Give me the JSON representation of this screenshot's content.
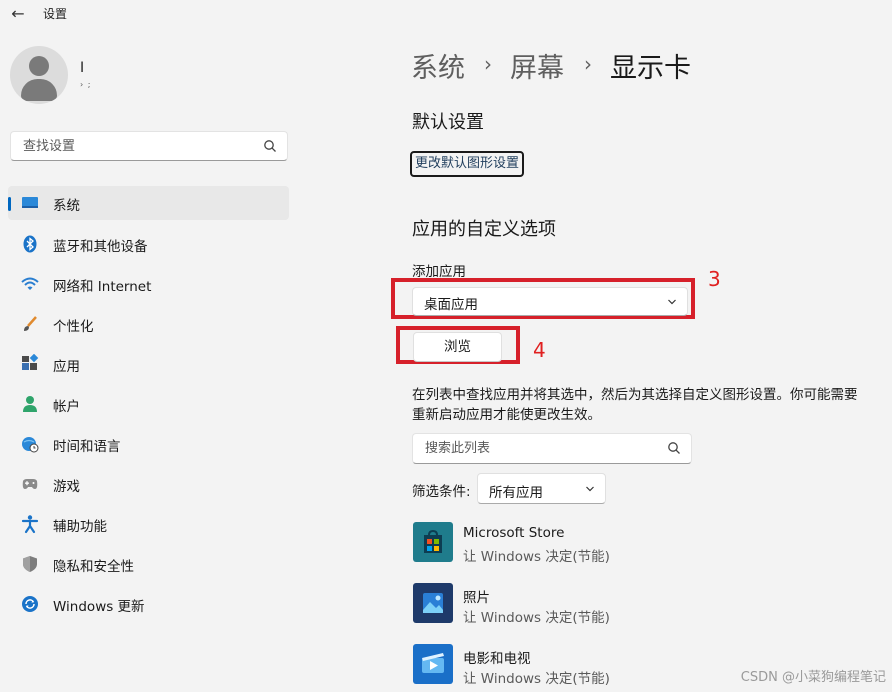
{
  "window": {
    "title": "设置",
    "back_icon": "back-arrow-icon"
  },
  "account": {
    "name": "I",
    "email": "›                              ;"
  },
  "search": {
    "placeholder": "查找设置",
    "icon": "search-icon"
  },
  "sidebar": {
    "items": [
      {
        "label": "系统",
        "icon": "monitor-icon",
        "selected": true
      },
      {
        "label": "蓝牙和其他设备",
        "icon": "bluetooth-icon"
      },
      {
        "label": "网络和 Internet",
        "icon": "wifi-icon"
      },
      {
        "label": "个性化",
        "icon": "brush-icon"
      },
      {
        "label": "应用",
        "icon": "apps-icon"
      },
      {
        "label": "帐户",
        "icon": "person-icon"
      },
      {
        "label": "时间和语言",
        "icon": "globe-clock-icon"
      },
      {
        "label": "游戏",
        "icon": "gamepad-icon"
      },
      {
        "label": "辅助功能",
        "icon": "accessibility-icon"
      },
      {
        "label": "隐私和安全性",
        "icon": "shield-icon"
      },
      {
        "label": "Windows 更新",
        "icon": "update-icon"
      }
    ]
  },
  "breadcrumb": {
    "items": [
      "系统",
      "屏幕",
      "显示卡"
    ],
    "separator": "›"
  },
  "default_settings": {
    "heading": "默认设置",
    "link": "更改默认图形设置"
  },
  "custom_options": {
    "heading": "应用的自定义选项",
    "add_app_label": "添加应用",
    "add_app_value": "桌面应用",
    "browse_label": "浏览",
    "annotation_3": "3",
    "annotation_4": "4",
    "description": "在列表中查找应用并将其选中，然后为其选择自定义图形设置。你可能需要重新启动应用才能使更改生效。",
    "list_search_placeholder": "搜索此列表",
    "filter_label": "筛选条件:",
    "filter_value": "所有应用"
  },
  "apps": [
    {
      "name": "Microsoft Store",
      "sub": "让 Windows 决定(节能)",
      "icon": "store-icon"
    },
    {
      "name": "照片",
      "sub": "让 Windows 决定(节能)",
      "icon": "photos-icon"
    },
    {
      "name": "电影和电视",
      "sub": "让 Windows 决定(节能)",
      "icon": "movies-icon"
    }
  ],
  "colors": {
    "accent": "#0067c0",
    "annotation": "#d6202a",
    "background": "#f3f3f3"
  },
  "watermark": "CSDN @小菜狗编程笔记"
}
